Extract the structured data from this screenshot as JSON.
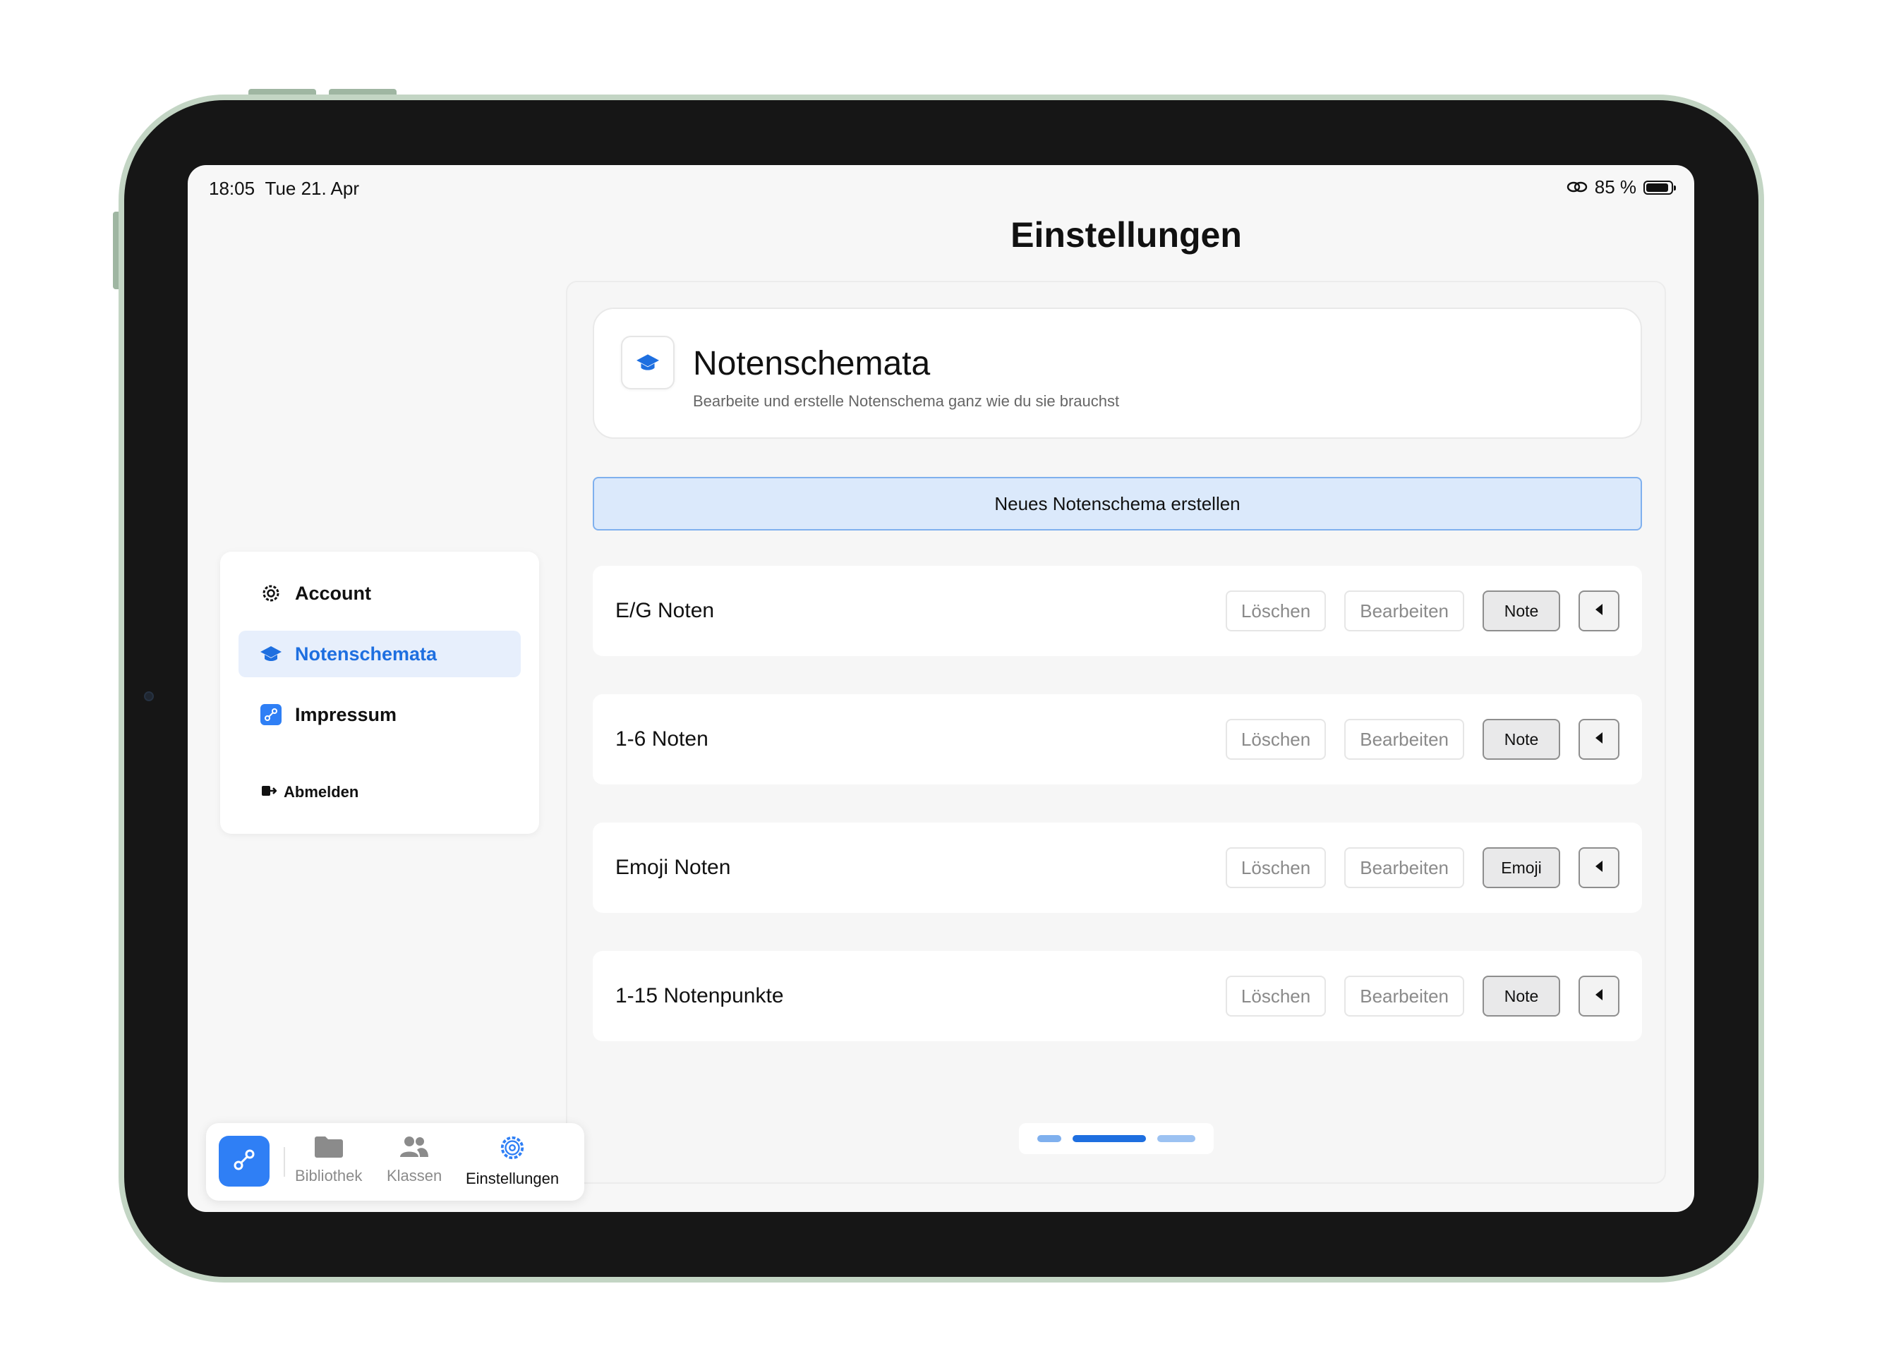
{
  "status_bar": {
    "time": "18:05",
    "date": "Tue 21. Apr",
    "battery": "85 %",
    "battery_level": 0.85
  },
  "page": {
    "title": "Einstellungen"
  },
  "sidebar": {
    "items": [
      {
        "label": "Account",
        "icon": "gear-icon",
        "active": false
      },
      {
        "label": "Notenschemata",
        "icon": "graduation-cap-icon",
        "active": true
      },
      {
        "label": "Impressum",
        "icon": "link-icon",
        "active": false
      }
    ],
    "logout_label": "Abmelden"
  },
  "header": {
    "title": "Notenschemata",
    "subtitle": "Bearbeite und erstelle Notenschema ganz wie du sie brauchst",
    "icon": "graduation-cap-icon"
  },
  "create_button": {
    "label": "Neues Notenschema erstellen"
  },
  "schemes": [
    {
      "name": "E/G Noten",
      "delete_label": "Löschen",
      "edit_label": "Bearbeiten",
      "type_label": "Note"
    },
    {
      "name": "1-6 Noten",
      "delete_label": "Löschen",
      "edit_label": "Bearbeiten",
      "type_label": "Note"
    },
    {
      "name": "Emoji Noten",
      "delete_label": "Löschen",
      "edit_label": "Bearbeiten",
      "type_label": "Emoji"
    },
    {
      "name": "1-15 Notenpunkte",
      "delete_label": "Löschen",
      "edit_label": "Bearbeiten",
      "type_label": "Note"
    }
  ],
  "pager": {
    "pages": 3,
    "current": 2
  },
  "tabbar": {
    "tabs": [
      {
        "label": "Bibliothek",
        "icon": "folder-icon",
        "active": false
      },
      {
        "label": "Klassen",
        "icon": "people-icon",
        "active": false
      },
      {
        "label": "Einstellungen",
        "icon": "gear-icon",
        "active": true
      }
    ]
  },
  "colors": {
    "accent": "#2f7ff5",
    "active_bg": "#e7effc",
    "create_bg": "#dbe9fb",
    "frame": "#c3d5c4"
  }
}
